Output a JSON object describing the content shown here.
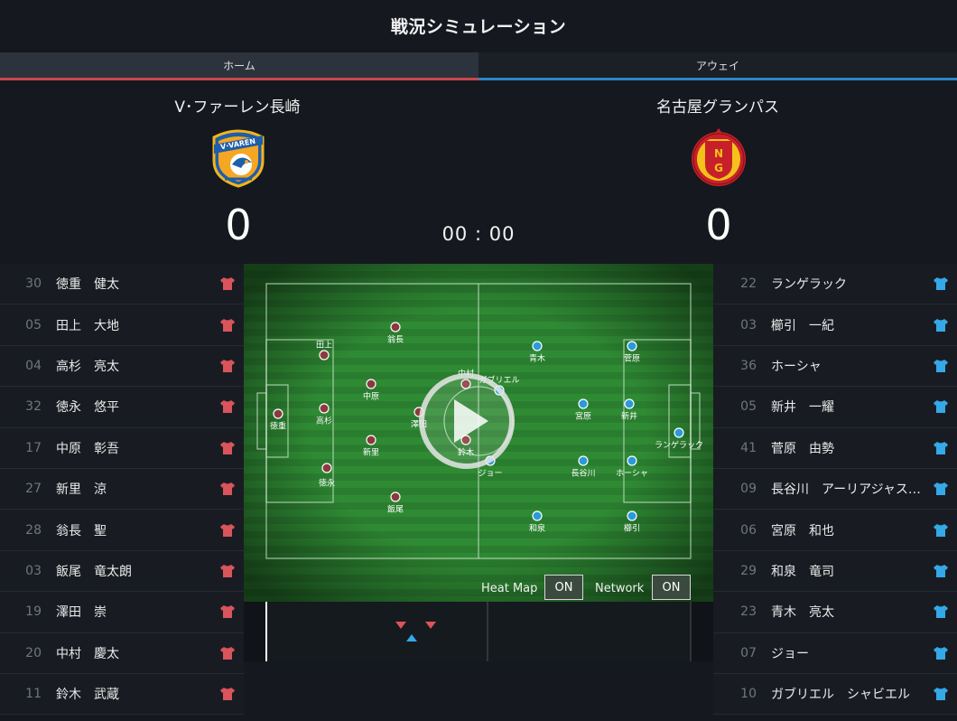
{
  "header": {
    "title": "戦況シミュレーション"
  },
  "tabs": {
    "home": "ホーム",
    "away": "アウェイ"
  },
  "match": {
    "home_team": "V･ファーレン長崎",
    "away_team": "名古屋グランパス",
    "home_score": "0",
    "away_score": "0",
    "clock": "00 : 00"
  },
  "colors": {
    "home": "#c9474b",
    "away": "#2b9ad8",
    "home_shirt": "#d9545b",
    "away_shirt": "#35a8e8"
  },
  "home_players": [
    {
      "num": "30",
      "name": "徳重　健太",
      "icon": "shirt-icon"
    },
    {
      "num": "05",
      "name": "田上　大地",
      "icon": "shirt-icon"
    },
    {
      "num": "04",
      "name": "高杉　亮太",
      "icon": "shirt-icon"
    },
    {
      "num": "32",
      "name": "徳永　悠平",
      "icon": "shirt-icon"
    },
    {
      "num": "17",
      "name": "中原　彰吾",
      "icon": "shirt-icon"
    },
    {
      "num": "27",
      "name": "新里　涼",
      "icon": "shirt-icon"
    },
    {
      "num": "28",
      "name": "翁長　聖",
      "icon": "shirt-icon"
    },
    {
      "num": "03",
      "name": "飯尾　竜太朗",
      "icon": "shirt-icon"
    },
    {
      "num": "19",
      "name": "澤田　崇",
      "icon": "shirt-icon"
    },
    {
      "num": "20",
      "name": "中村　慶太",
      "icon": "shirt-icon"
    },
    {
      "num": "11",
      "name": "鈴木　武蔵",
      "icon": "shirt-icon"
    }
  ],
  "away_players": [
    {
      "num": "22",
      "name": "ランゲラック",
      "icon": "shirt-icon"
    },
    {
      "num": "03",
      "name": "櫛引　一紀",
      "icon": "shirt-icon"
    },
    {
      "num": "36",
      "name": "ホーシャ",
      "icon": "shirt-icon"
    },
    {
      "num": "05",
      "name": "新井　一耀",
      "icon": "shirt-icon"
    },
    {
      "num": "41",
      "name": "菅原　由勢",
      "icon": "shirt-icon"
    },
    {
      "num": "09",
      "name": "長谷川　アーリアジャスール",
      "icon": "shirt-icon"
    },
    {
      "num": "06",
      "name": "宮原　和也",
      "icon": "shirt-icon"
    },
    {
      "num": "29",
      "name": "和泉　竜司",
      "icon": "shirt-icon"
    },
    {
      "num": "23",
      "name": "青木　亮太",
      "icon": "shirt-icon"
    },
    {
      "num": "07",
      "name": "ジョー",
      "icon": "shirt-icon"
    },
    {
      "num": "10",
      "name": "ガブリエル　シャビエル",
      "icon": "shirt-icon"
    }
  ],
  "pitch": {
    "home_markers": [
      {
        "label": "徳重"
      },
      {
        "label": "田上"
      },
      {
        "label": "高杉"
      },
      {
        "label": "徳永"
      },
      {
        "label": "翁長"
      },
      {
        "label": "中原"
      },
      {
        "label": "新里"
      },
      {
        "label": "飯尾"
      },
      {
        "label": "澤田"
      },
      {
        "label": "中村"
      },
      {
        "label": "鈴木"
      }
    ],
    "away_markers": [
      {
        "label": "ランゲラック"
      },
      {
        "label": "菅原"
      },
      {
        "label": "新井"
      },
      {
        "label": "ホーシャ"
      },
      {
        "label": "櫛引"
      },
      {
        "label": "青木"
      },
      {
        "label": "宮原"
      },
      {
        "label": "長谷川"
      },
      {
        "label": "和泉"
      },
      {
        "label": "ガブリエル"
      },
      {
        "label": "ジョー"
      }
    ],
    "play_icon": "play-icon"
  },
  "controls": {
    "heatmap_label": "Heat Map",
    "heatmap_value": "ON",
    "network_label": "Network",
    "network_value": "ON"
  }
}
